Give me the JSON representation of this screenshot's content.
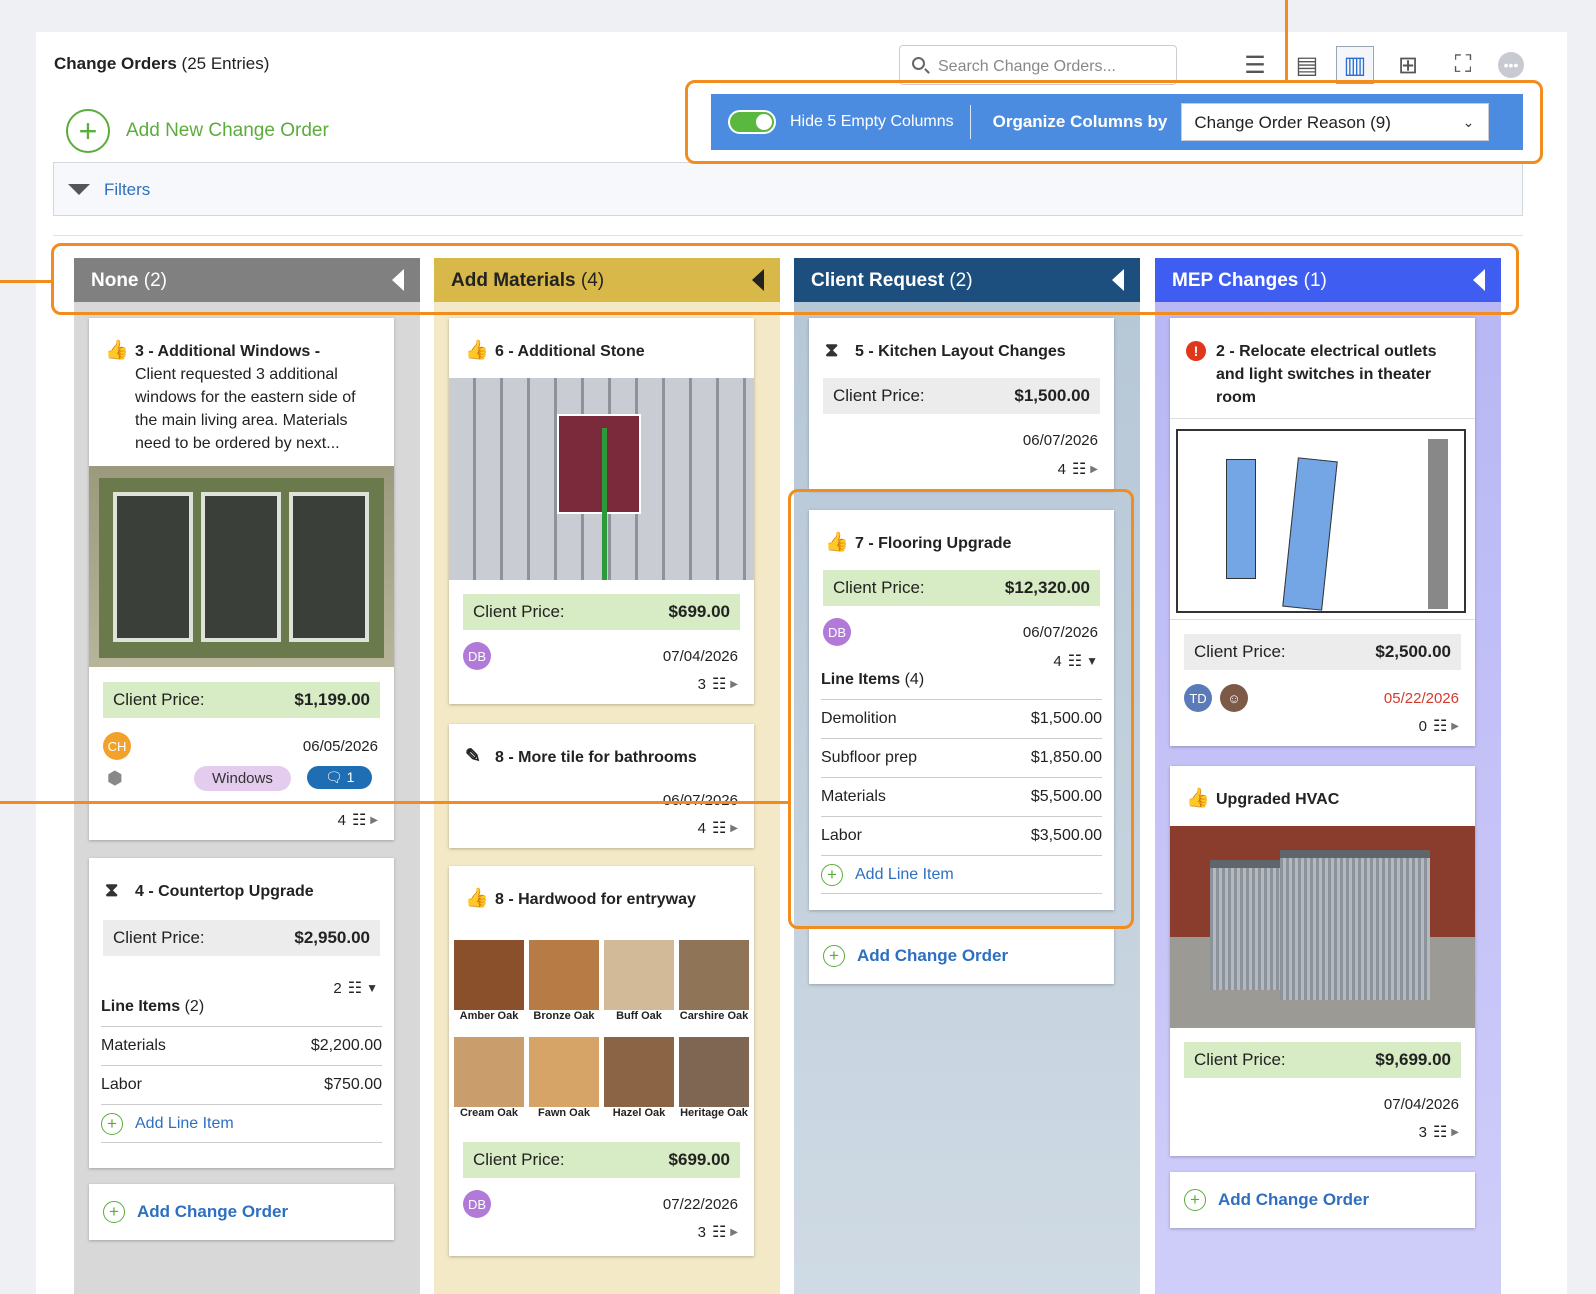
{
  "header": {
    "title": "Change Orders",
    "entries": "(25 Entries)",
    "add_new_label": "Add New Change Order",
    "search_placeholder": "Search Change Orders..."
  },
  "toolbar": {
    "hide_empty_label": "Hide 5 Empty Columns",
    "organize_label": "Organize Columns by",
    "organize_value": "Change Order Reason (9)",
    "view_icons": [
      "list-icon",
      "detail-list-icon",
      "board-icon",
      "grid-icon",
      "fullscreen-icon",
      "more-icon"
    ]
  },
  "filters": {
    "label": "Filters"
  },
  "columns": [
    {
      "name": "None",
      "count": "(2)",
      "color": "#808080"
    },
    {
      "name": "Add Materials",
      "count": "(4)",
      "color": "#d9b84a"
    },
    {
      "name": "Client Request",
      "count": "(2)",
      "color": "#1c4f7e"
    },
    {
      "name": "MEP Changes",
      "count": "(1)",
      "color": "#3f5df0"
    }
  ],
  "cards": {
    "c3": {
      "title": "3 - Additional Windows",
      "desc": "Client requested 3 additional windows for the eastern side of the main living area. Materials need to be ordered by next...",
      "price_label": "Client Price:",
      "price": "$1,199.00",
      "avatar": "CH",
      "date": "06/05/2026",
      "tag": "Windows",
      "comments": "1",
      "items": "4"
    },
    "c4": {
      "title": "4 - Countertop Upgrade",
      "price_label": "Client Price:",
      "price": "$2,950.00",
      "items": "2",
      "line_items_label": "Line Items",
      "line_items_count": "(2)",
      "lines": [
        {
          "name": "Materials",
          "amount": "$2,200.00"
        },
        {
          "name": "Labor",
          "amount": "$750.00"
        }
      ],
      "add_line": "Add Line Item"
    },
    "c6": {
      "title": "6 - Additional Stone",
      "price_label": "Client Price:",
      "price": "$699.00",
      "avatar": "DB",
      "date": "07/04/2026",
      "items": "3"
    },
    "c8a": {
      "title": "8 - More tile for bathrooms",
      "date": "06/07/2026",
      "items": "4"
    },
    "c8b": {
      "title": "8 - Hardwood for entryway",
      "price_label": "Client Price:",
      "price": "$699.00",
      "avatar": "DB",
      "date": "07/22/2026",
      "items": "3",
      "woods": [
        "Amber Oak",
        "Bronze Oak",
        "Buff Oak",
        "Carshire Oak",
        "Cream Oak",
        "Fawn Oak",
        "Hazel Oak",
        "Heritage Oak"
      ]
    },
    "c5": {
      "title": "5 - Kitchen Layout Changes",
      "price_label": "Client Price:",
      "price": "$1,500.00",
      "date": "06/07/2026",
      "items": "4"
    },
    "c7": {
      "title": "7 - Flooring Upgrade",
      "price_label": "Client Price:",
      "price": "$12,320.00",
      "avatar": "DB",
      "date": "06/07/2026",
      "items": "4",
      "line_items_label": "Line Items",
      "line_items_count": "(4)",
      "lines": [
        {
          "name": "Demolition",
          "amount": "$1,500.00"
        },
        {
          "name": "Subfloor prep",
          "amount": "$1,850.00"
        },
        {
          "name": "Materials",
          "amount": "$5,500.00"
        },
        {
          "name": "Labor",
          "amount": "$3,500.00"
        }
      ],
      "add_line": "Add Line Item"
    },
    "c2": {
      "title": "2 - Relocate electrical outlets and light switches in theater room",
      "price_label": "Client Price:",
      "price": "$2,500.00",
      "avatar": "TD",
      "date": "05/22/2026",
      "items": "0"
    },
    "hvac": {
      "title": "Upgraded HVAC",
      "price_label": "Client Price:",
      "price": "$9,699.00",
      "date": "07/04/2026",
      "items": "3"
    }
  },
  "add_change_order": "Add Change Order",
  "colors": {
    "accent_orange": "#f28c1e",
    "green": "#5cac3c",
    "blue_link": "#2f6fc0",
    "org_bar": "#4c8ce0"
  }
}
